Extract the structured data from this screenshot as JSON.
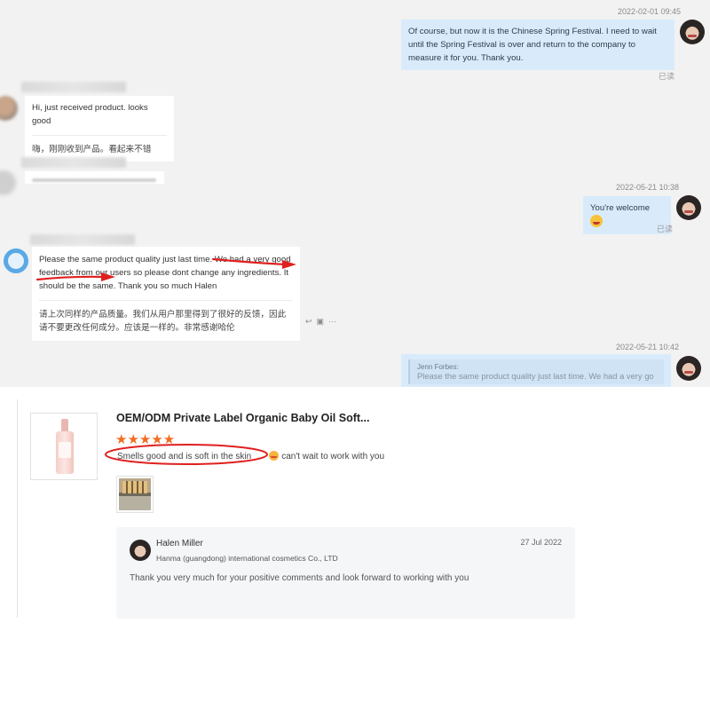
{
  "chat": {
    "messages": [
      {
        "timestamp": "2022-02-01 09:45",
        "text": "Of course, but now it is the Chinese Spring Festival. I need to wait until the Spring Festival is over and return to the company to measure it for you. Thank you.",
        "status": "已读"
      },
      {
        "text": "Hi, just received product. looks good",
        "translation": "嗨，刚刚收到产品。看起来不错"
      },
      {
        "timestamp": "2022-05-21 10:38",
        "text": "You're welcome",
        "status": "已读"
      },
      {
        "text_part1": "Please the same product quality just last time. ",
        "text_part2": "We had a very good feedback from our users so please dont change any ingredients.",
        "text_part3": " It should be the same. Thank you so much Halen",
        "translation": "请上次同样的产品质量。我们从用户那里得到了很好的反馈，因此请不要更改任何成分。应该是一样的。非常感谢哈伦"
      },
      {
        "timestamp": "2022-05-21 10:42",
        "quote_name": "Jenn Forbes:",
        "quote_text": "Please the same product quality just last time. We had a very go"
      }
    ]
  },
  "review": {
    "product_title": "OEM/ODM Private Label Organic Baby Oil Soft...",
    "rating": 5,
    "stars": "★★★★★",
    "review_text": "Smells good and is soft in the skin",
    "review_text_2": "can't wait to work with you",
    "reply": {
      "name": "Halen Miller",
      "company": "Hanma (guangdong) international cosmetics Co., LTD",
      "date": "27 Jul 2022",
      "body": "Thank you very much for your positive comments and look forward to working with you"
    }
  },
  "colors": {
    "chat_bg": "#f2f2f2",
    "outgoing_bubble": "#d9ebfb",
    "star": "#f36c21",
    "annotation_red": "#e02020"
  }
}
